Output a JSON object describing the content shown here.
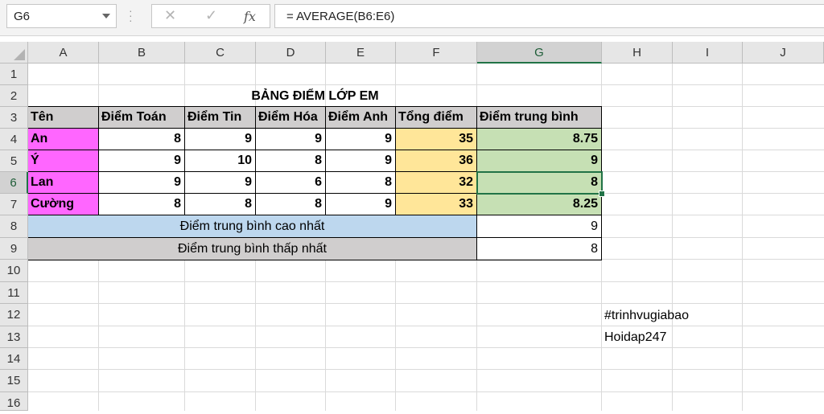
{
  "name_box": "G6",
  "formula": "= AVERAGE(B6:E6)",
  "columns": [
    "A",
    "B",
    "C",
    "D",
    "E",
    "F",
    "G",
    "H",
    "I",
    "J"
  ],
  "rows": [
    "1",
    "2",
    "3",
    "4",
    "5",
    "6",
    "7",
    "8",
    "9",
    "10",
    "11",
    "12",
    "13",
    "14",
    "15",
    "16"
  ],
  "sheet": {
    "title": "BẢNG ĐIỂM LỚP EM",
    "headers": [
      "Tên",
      "Điểm Toán",
      "Điểm Tin",
      "Điểm Hóa",
      "Điểm Anh",
      "Tổng điểm",
      "Điểm trung bình"
    ],
    "students": [
      {
        "name": "An",
        "toan": "8",
        "tin": "9",
        "hoa": "9",
        "anh": "9",
        "tong": "35",
        "tb": "8.75"
      },
      {
        "name": "Ý",
        "toan": "9",
        "tin": "10",
        "hoa": "8",
        "anh": "9",
        "tong": "36",
        "tb": "9"
      },
      {
        "name": "Lan",
        "toan": "9",
        "tin": "9",
        "hoa": "6",
        "anh": "8",
        "tong": "32",
        "tb": "8"
      },
      {
        "name": "Cường",
        "toan": "8",
        "tin": "8",
        "hoa": "8",
        "anh": "9",
        "tong": "33",
        "tb": "8.25"
      }
    ],
    "max_label": "Điểm trung bình cao nhất",
    "max_value": "9",
    "min_label": "Điểm trung bình thấp nhất",
    "min_value": "8",
    "note1": "#trinhvugiabao",
    "note2": "Hoidap247"
  },
  "colors": {
    "pink": "#ff66ff",
    "yellow": "#ffe699",
    "green": "#c6e0b4",
    "blue": "#bdd7ee",
    "gray": "#d0cece",
    "accent": "#217346"
  }
}
